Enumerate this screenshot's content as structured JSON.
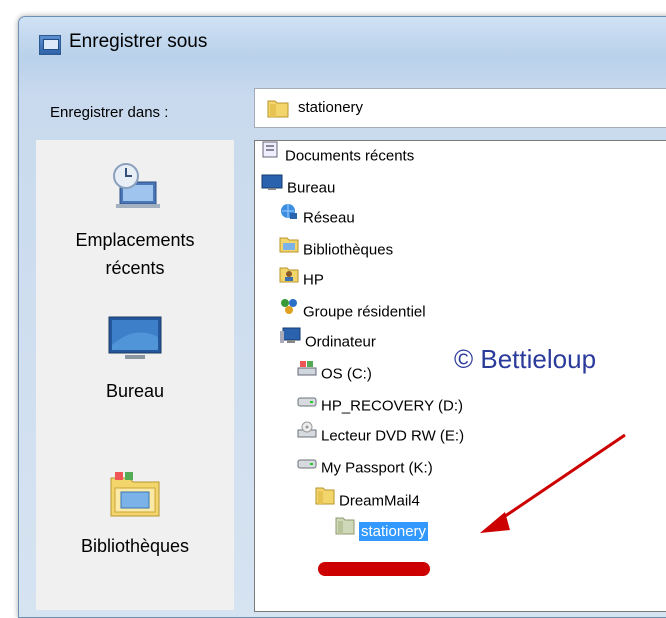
{
  "window": {
    "title": "Enregistrer sous"
  },
  "lookin": {
    "label": "Enregistrer dans :",
    "value": "stationery"
  },
  "places": [
    {
      "label_lines": [
        "Emplacements",
        "récents"
      ],
      "icon": "recent-places-icon"
    },
    {
      "label_lines": [
        "Bureau"
      ],
      "icon": "desktop-icon"
    },
    {
      "label_lines": [
        "Bibliothèques"
      ],
      "icon": "libraries-icon"
    }
  ],
  "dropdown": {
    "items": [
      {
        "label": "Documents récents",
        "icon": "recent-documents-icon"
      },
      {
        "label": "Bureau",
        "icon": "desktop-icon"
      },
      {
        "label": "Réseau",
        "icon": "network-icon"
      },
      {
        "label": "Bibliothèques",
        "icon": "libraries-icon"
      },
      {
        "label": "HP",
        "icon": "user-folder-icon"
      },
      {
        "label": "Groupe résidentiel",
        "icon": "homegroup-icon"
      },
      {
        "label": "Ordinateur",
        "icon": "computer-icon"
      },
      {
        "label": "OS (C:)",
        "icon": "system-drive-icon"
      },
      {
        "label": "HP_RECOVERY (D:)",
        "icon": "drive-icon"
      },
      {
        "label": "Lecteur DVD RW (E:)",
        "icon": "dvd-drive-icon"
      },
      {
        "label": "My Passport (K:)",
        "icon": "drive-icon"
      },
      {
        "label": "DreamMail4",
        "icon": "folder-icon"
      },
      {
        "label": "stationery",
        "icon": "folder-icon",
        "selected": true
      }
    ]
  },
  "watermark": "© Bettieloup",
  "colors": {
    "selection": "#3399ff",
    "arrow": "#cc0000",
    "watermark": "#2b3b9c"
  }
}
